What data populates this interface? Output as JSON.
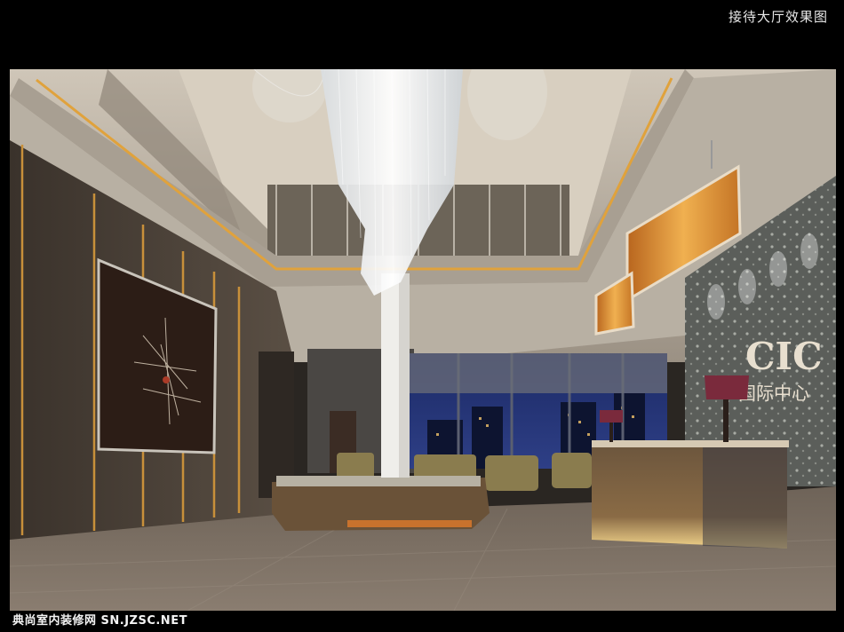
{
  "caption": {
    "title": "接待大厅效果图"
  },
  "watermark": {
    "text": "典尚室内装修网 SN.JZSC.NET"
  },
  "scene": {
    "wall_logo_letters": "CIC",
    "wall_logo_name": "国际中心"
  }
}
